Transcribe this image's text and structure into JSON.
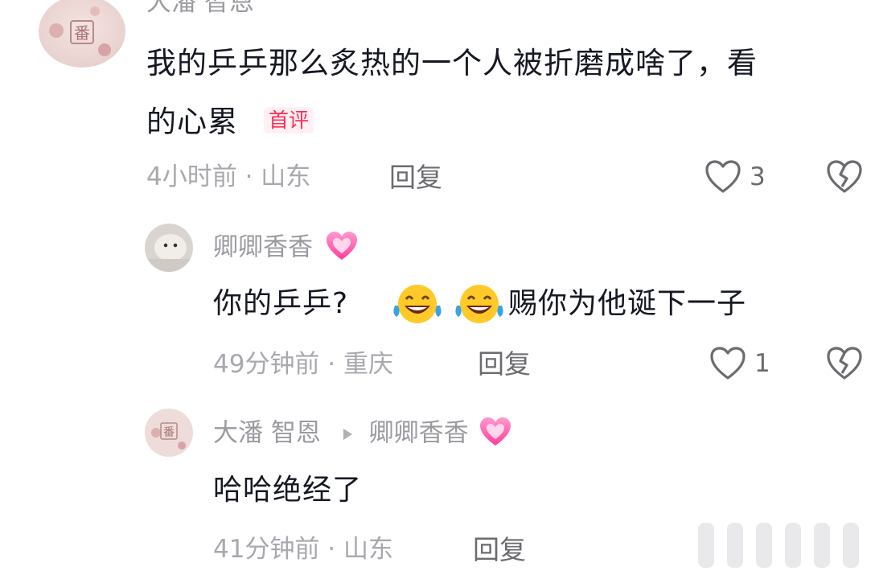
{
  "comments": [
    {
      "author": "大潘 智恩",
      "text_line1": "我的乒乒那么炙热的一个人被折磨成啥了，看",
      "text_line2": "的心累",
      "badge": "首评",
      "time_location": "4小时前 · 山东",
      "reply_label": "回复",
      "likes": "3"
    },
    {
      "author": "卿卿香香",
      "text_before": "你的乒乒?",
      "text_after": "赐你为他诞下一子",
      "time_location": "49分钟前 · 重庆",
      "reply_label": "回复",
      "likes": "1"
    },
    {
      "author": "大潘 智恩",
      "reply_to": "卿卿香香",
      "text": "哈哈绝经了",
      "time_location": "41分钟前 · 山东",
      "reply_label": "回复"
    }
  ],
  "colors": {
    "text": "#161823",
    "meta": "#a8a8ae",
    "badge": "#fe2c55"
  }
}
